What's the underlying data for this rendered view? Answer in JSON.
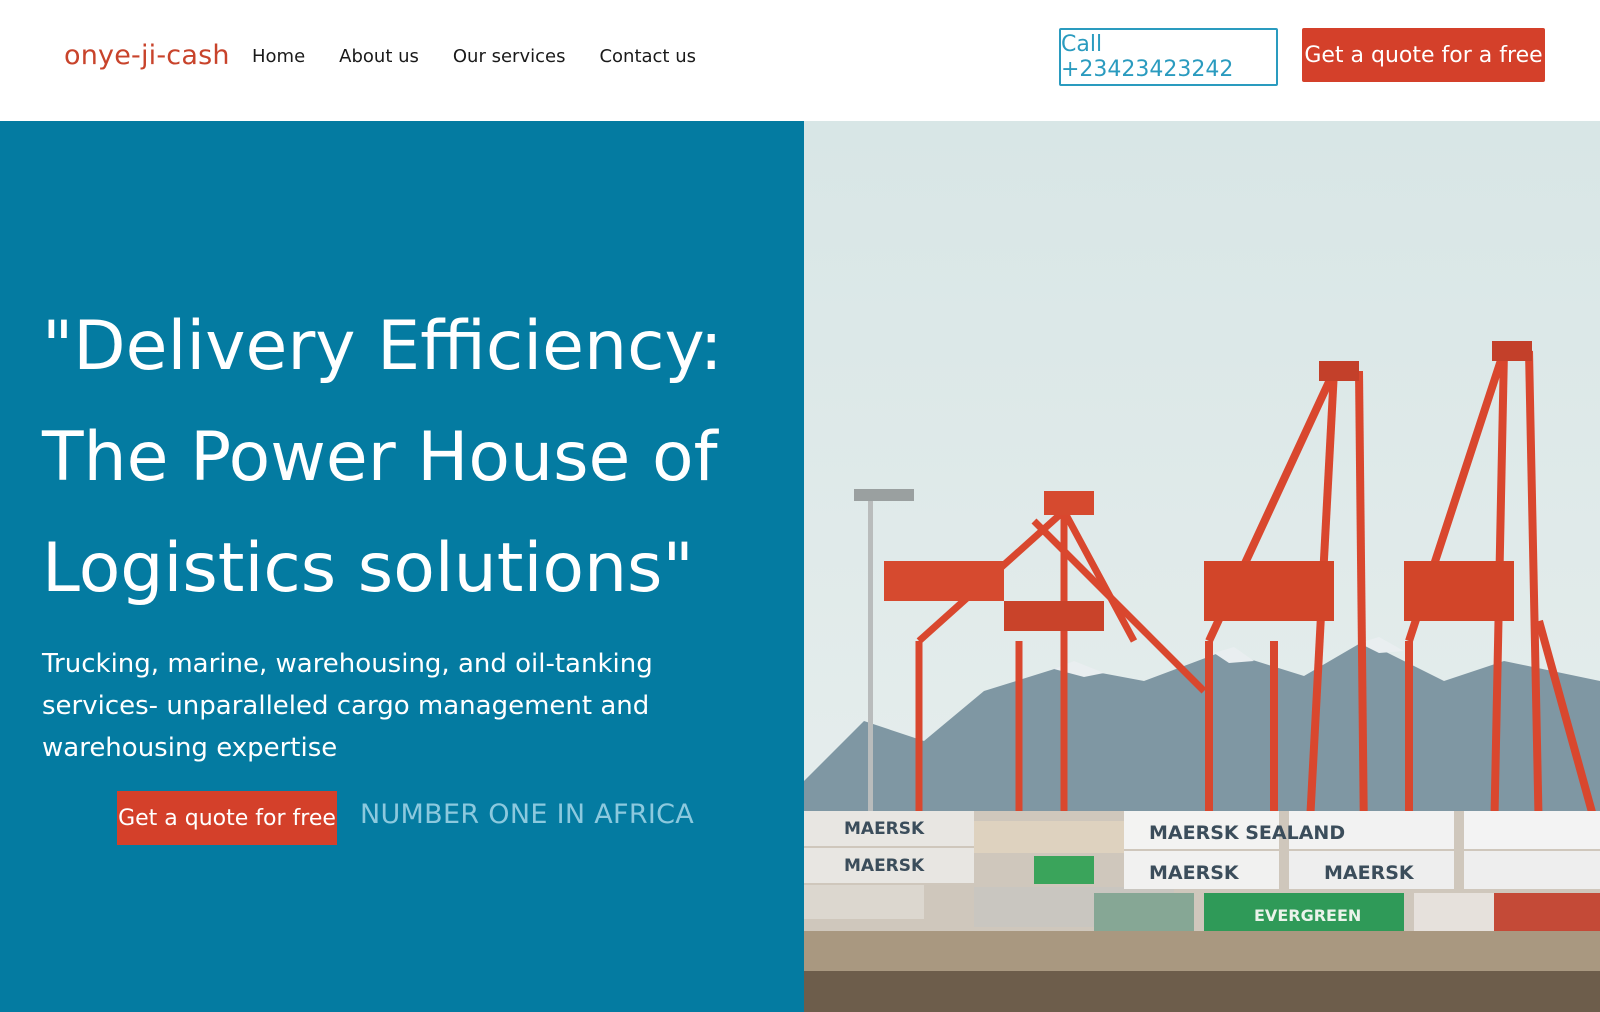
{
  "header": {
    "logo": "onye-ji-cash",
    "nav": [
      "Home",
      "About us",
      "Our services",
      "Contact us"
    ],
    "call_label": "Call +23423423242",
    "quote_label": "Get a quote for a free"
  },
  "hero": {
    "title": "\"Delivery Efficiency: The Power House of Logistics solutions\"",
    "subtitle": "Trucking, marine, warehousing, and oil-tanking services- unparalleled cargo management and warehousing expertise",
    "quote_button": "Get a quote for free",
    "tagline": "NUMBER ONE IN AFRICA"
  },
  "image": {
    "container_labels": [
      "MAERSK",
      "MAERSK",
      "MAERSK SEALAND",
      "MAERSK",
      "EVERGREEN",
      "MAERSK"
    ]
  },
  "colors": {
    "brand": "#c8432b",
    "hero_bg": "#047ba1",
    "accent_button": "#d4402a",
    "call_outline": "#2a9bbf"
  }
}
